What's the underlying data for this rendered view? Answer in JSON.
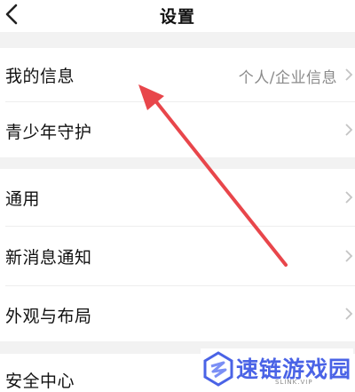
{
  "header": {
    "title": "设置",
    "back_icon": "chevron-left-icon"
  },
  "settings": {
    "my_info": {
      "label": "我的信息",
      "value": "个人/企业信息"
    },
    "youth_guard": {
      "label": "青少年守护"
    },
    "general": {
      "label": "通用"
    },
    "new_message_notify": {
      "label": "新消息通知"
    },
    "appearance_layout": {
      "label": "外观与布局"
    },
    "security_center": {
      "label": "安全中心"
    }
  },
  "annotation": {
    "color": "#e8464b",
    "icon": "red-arrow"
  },
  "watermark": {
    "logo_icon": "speedlink-logo-icon",
    "text": "速链游戏园",
    "subtext": "SLINK.VIP",
    "color": "#4a63e6"
  }
}
